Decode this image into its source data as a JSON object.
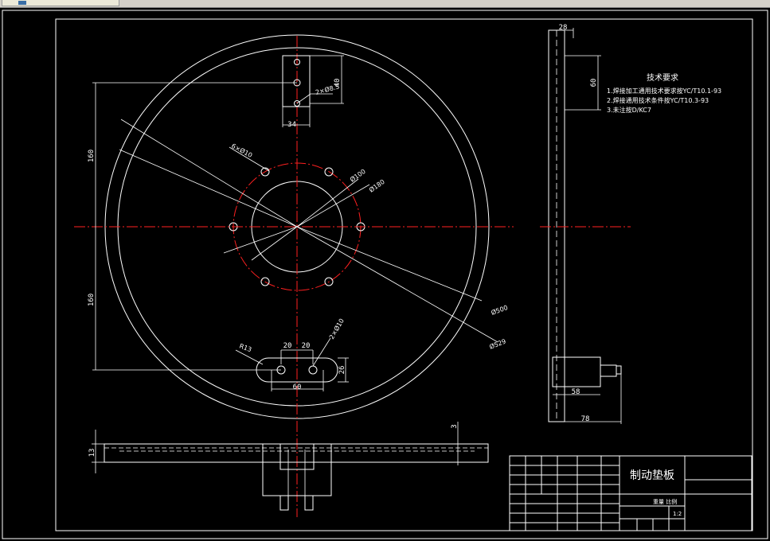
{
  "window": {
    "tab_icon": "drawing-file-icon"
  },
  "notes": {
    "title": "技术要求",
    "items": [
      "1.焊接加工通用技术要求按YC/T10.1-93",
      "2.焊接通用技术条件按YC/T10.3-93",
      "3.未注按D/KC7"
    ]
  },
  "title_block": {
    "part_name": "制动垫板",
    "scale_label": "重量 比例",
    "scale_value": "1:2"
  },
  "dimensions": {
    "main_diameter": "Ø500",
    "outer_diameter": "Ø529",
    "bolt_circle": "Ø180",
    "inner_circle": "Ø100",
    "holes": "6×Ø10",
    "top_hole": "2×Ø8.5",
    "top_height": "40",
    "top_width": "34",
    "upper_offset": "160",
    "lower_offset": "160",
    "slot_pitch_left": "20",
    "slot_pitch_right": "20",
    "slot_width": "60",
    "slot_radius": "R13",
    "slot_hole": "2×Ø10",
    "slot_height": "26",
    "thickness": "13",
    "step": "3",
    "side_top_width": "28",
    "side_height": "60",
    "side_hub_width": "58",
    "side_total_width": "78"
  }
}
